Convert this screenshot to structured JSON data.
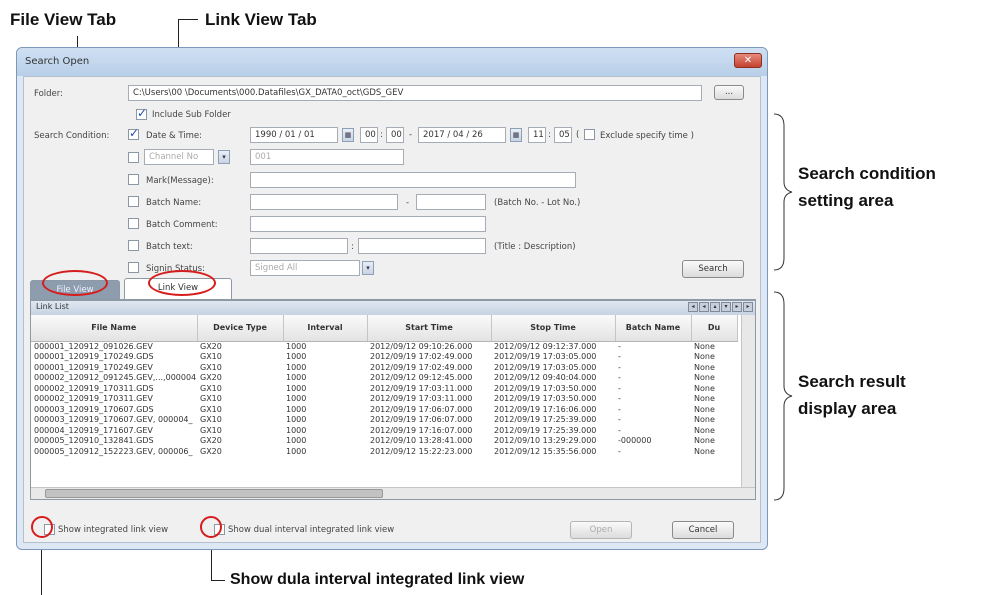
{
  "callouts": {
    "file_view_tab": "File View Tab",
    "link_view_tab": "Link View Tab",
    "search_condition": "Search condition setting area",
    "search_result": "Search result display area",
    "dual_interval": "Show dula interval integrated link view"
  },
  "dialog": {
    "title": "Search Open",
    "close": "✕",
    "folder_label": "Folder:",
    "folder_value": "C:\\Users\\00          \\Documents\\000.Datafiles\\GX_DATA0_oct\\GDS_GEV",
    "browse": "...",
    "include_sub": "Include Sub Folder",
    "search_condition_label": "Search Condition:",
    "date_time": "Date & Time:",
    "from_date": "1990  /  01  /  01",
    "from_hh": "00",
    "from_mm": "00",
    "dash": "-",
    "to_date": "2017  /  04  /  26",
    "to_hh": "11",
    "to_mm": "05",
    "exclude_open": "(",
    "exclude": "Exclude specify time )",
    "channel_no": "Channel No",
    "channel_value": "001",
    "mark": "Mark(Message):",
    "batch_name": "Batch Name:",
    "batch_dash": "-",
    "batch_hint": "(Batch No. - Lot No.)",
    "batch_comment": "Batch Comment:",
    "batch_text": "Batch text:",
    "colon": ":",
    "text_hint": "(Title : Description)",
    "signin_status": "Signin Status:",
    "signin_value": "Signed All",
    "search_btn": "Search",
    "tab_file": "File View",
    "tab_link": "Link View",
    "link_list": "Link List",
    "show_integrated": "Show integrated link view",
    "show_dual": "Show dual interval integrated link view",
    "open_btn": "Open",
    "cancel_btn": "Cancel"
  },
  "table": {
    "columns": [
      "File Name",
      "Device Type",
      "Interval",
      "Start Time",
      "Stop Time",
      "Batch Name",
      "Du"
    ],
    "rows": [
      [
        "000001_120912_091026.GEV",
        "GX20",
        "1000",
        "2012/09/12 09:10:26.000",
        "2012/09/12 09:12:37.000",
        "-",
        "None"
      ],
      [
        "000001_120919_170249.GDS",
        "GX10",
        "1000",
        "2012/09/19 17:02:49.000",
        "2012/09/19 17:03:05.000",
        "-",
        "None"
      ],
      [
        "000001_120919_170249.GEV",
        "GX10",
        "1000",
        "2012/09/19 17:02:49.000",
        "2012/09/19 17:03:05.000",
        "-",
        "None"
      ],
      [
        "000002_120912_091245.GEV,...,000004",
        "GX20",
        "1000",
        "2012/09/12 09:12:45.000",
        "2012/09/12 09:40:04.000",
        "-",
        "None"
      ],
      [
        "000002_120919_170311.GDS",
        "GX10",
        "1000",
        "2012/09/19 17:03:11.000",
        "2012/09/19 17:03:50.000",
        "-",
        "None"
      ],
      [
        "000002_120919_170311.GEV",
        "GX10",
        "1000",
        "2012/09/19 17:03:11.000",
        "2012/09/19 17:03:50.000",
        "-",
        "None"
      ],
      [
        "000003_120919_170607.GDS",
        "GX10",
        "1000",
        "2012/09/19 17:06:07.000",
        "2012/09/19 17:16:06.000",
        "-",
        "None"
      ],
      [
        "000003_120919_170607.GEV, 000004_",
        "GX10",
        "1000",
        "2012/09/19 17:06:07.000",
        "2012/09/19 17:25:39.000",
        "-",
        "None"
      ],
      [
        "000004_120919_171607.GEV",
        "GX10",
        "1000",
        "2012/09/19 17:16:07.000",
        "2012/09/19 17:25:39.000",
        "-",
        "None"
      ],
      [
        "000005_120910_132841.GDS",
        "GX20",
        "1000",
        "2012/09/10 13:28:41.000",
        "2012/09/10 13:29:29.000",
        "-000000",
        "None"
      ],
      [
        "000005_120912_152223.GEV, 000006_",
        "GX20",
        "1000",
        "2012/09/12 15:22:23.000",
        "2012/09/12 15:35:56.000",
        "-",
        "None"
      ]
    ]
  },
  "colors": {
    "circle": "#d61d1d",
    "selected_row_bg": "#ffffff"
  }
}
